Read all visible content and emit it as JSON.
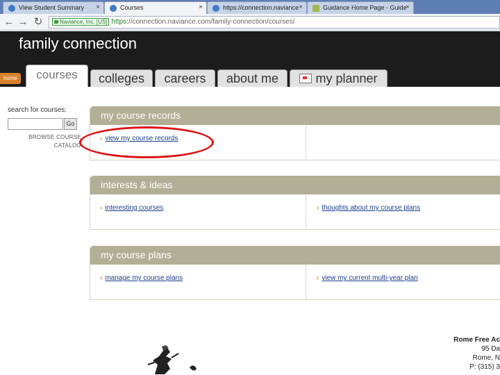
{
  "browser": {
    "tabs": [
      {
        "title": "View Student Summary",
        "active": false
      },
      {
        "title": "Courses",
        "active": true
      },
      {
        "title": "https://connection.naviance",
        "active": false
      },
      {
        "title": "Guidance Home Page - Guide",
        "active": false
      }
    ],
    "ev_badge": "Naviance, Inc. [US]",
    "url_scheme": "https",
    "url_rest": "://connection.naviance.com/family-connection/courses/"
  },
  "header": {
    "site_title": "family connection",
    "home_label": "home",
    "nav_tabs": [
      {
        "label": "courses",
        "active": true
      },
      {
        "label": "colleges",
        "active": false
      },
      {
        "label": "careers",
        "active": false
      },
      {
        "label": "about me",
        "active": false
      },
      {
        "label": "my planner",
        "active": false
      }
    ]
  },
  "sidebar": {
    "search_label": "search for courses:",
    "search_value": "",
    "go_label": "Go",
    "browse_line1": "BROWSE COURSE",
    "browse_line2": "CATALOG"
  },
  "panels": [
    {
      "title": "my course records",
      "links": [
        "view my course records"
      ]
    },
    {
      "title": "interests & ideas",
      "links": [
        "interesting courses",
        "thoughts about my course plans"
      ]
    },
    {
      "title": "my course plans",
      "links": [
        "manage my course plans",
        "view my current multi-year plan"
      ]
    }
  ],
  "footer": {
    "school_name": "Rome Free Ac",
    "addr1": "95 Da",
    "addr2": "Rome, N",
    "phone": "P: (315) 3"
  },
  "colors": {
    "panel_header": "#b3ae96",
    "chevron": "#d89b0f",
    "home_tab": "#d9822b",
    "annotation": "#dd1111"
  }
}
